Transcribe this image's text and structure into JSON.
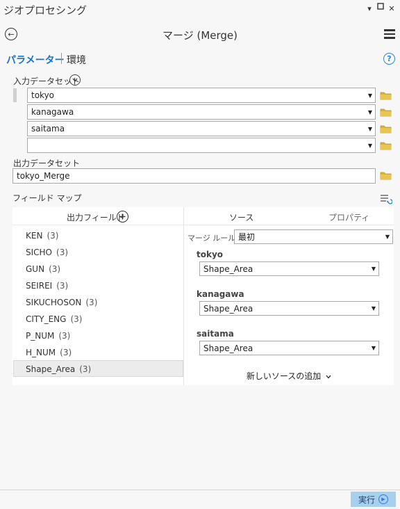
{
  "window": {
    "title": "ジオプロセシング",
    "pin_glyph": "▾",
    "restore_glyph": "▫",
    "close_glyph": "✕"
  },
  "header": {
    "tool_title": "マージ (Merge)",
    "back_glyph": "←"
  },
  "tabs": {
    "parameters": "パラメーター",
    "environments": "環境",
    "help_glyph": "?"
  },
  "inputs": {
    "label": "入力データセット",
    "rows": [
      {
        "value": "tokyo"
      },
      {
        "value": "kanagawa"
      },
      {
        "value": "saitama"
      },
      {
        "value": ""
      }
    ]
  },
  "output": {
    "label": "出力データセット",
    "value": "tokyo_Merge"
  },
  "field_map": {
    "label": "フィールド マップ",
    "output_fields_header": "出力フィールド",
    "source_tab": "ソース",
    "properties_tab": "プロパティ",
    "fields": [
      {
        "name": "KEN",
        "count": "(3)"
      },
      {
        "name": "SICHO",
        "count": "(3)"
      },
      {
        "name": "GUN",
        "count": "(3)"
      },
      {
        "name": "SEIREI",
        "count": "(3)"
      },
      {
        "name": "SIKUCHOSON",
        "count": "(3)"
      },
      {
        "name": "CITY_ENG",
        "count": "(3)"
      },
      {
        "name": "P_NUM",
        "count": "(3)"
      },
      {
        "name": "H_NUM",
        "count": "(3)"
      },
      {
        "name": "Shape_Area",
        "count": "(3)"
      }
    ],
    "merge_rule_label": "マージ ルール",
    "merge_rule_value": "最初",
    "sources": [
      {
        "name": "tokyo",
        "field": "Shape_Area"
      },
      {
        "name": "kanagawa",
        "field": "Shape_Area"
      },
      {
        "name": "saitama",
        "field": "Shape_Area"
      }
    ],
    "add_source": "新しいソースの追加"
  },
  "footer": {
    "run_label": "実行"
  },
  "colors": {
    "accent": "#1a73c7",
    "folder": "#d9b43a",
    "run_bg": "#a7d0ef"
  }
}
